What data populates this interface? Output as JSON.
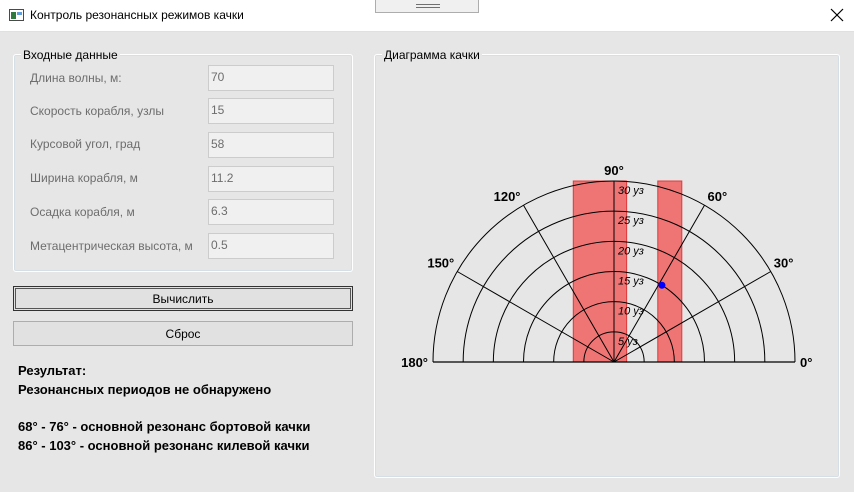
{
  "window": {
    "title": "Контроль резонансных режимов качки",
    "icon": "app-window-icon",
    "close_icon": "close-icon"
  },
  "input_group": {
    "title": "Входные данные",
    "fields": [
      {
        "label": "Длина волны, м:",
        "value": "70"
      },
      {
        "label": "Скорость корабля, узлы",
        "value": "15"
      },
      {
        "label": "Курсовой угол, град",
        "value": "58"
      },
      {
        "label": "Ширина корабля, м",
        "value": "11.2"
      },
      {
        "label": "Осадка корабля, м",
        "value": "6.3"
      },
      {
        "label": "Метацентрическая высота, м",
        "value": "0.5"
      }
    ]
  },
  "buttons": {
    "calculate": "Вычислить",
    "reset": "Сброс"
  },
  "result": {
    "title": "Результат:",
    "status": "Резонансных периодов не обнаружено",
    "roll": "68° - 76° - основной резонанс бортовой качки",
    "pitch": "86° - 103° - основной резонанс килевой качки"
  },
  "chart_group": {
    "title": "Диаграмма качки"
  },
  "chart_data": {
    "type": "polar",
    "angle_range": [
      0,
      180
    ],
    "angle_ticks": [
      0,
      30,
      60,
      90,
      120,
      150,
      180
    ],
    "angle_tick_labels": [
      "0°",
      "30°",
      "60°",
      "90°",
      "120°",
      "150°",
      "180°"
    ],
    "radial_unit": "уз",
    "radial_max": 30,
    "radial_ticks": [
      5,
      10,
      15,
      20,
      25,
      30
    ],
    "radial_tick_labels": [
      "5 уз",
      "10 уз",
      "15 уз",
      "20 уз",
      "25 уз",
      "30 уз"
    ],
    "grid": true,
    "resonance_bands": [
      {
        "name": "бортовая качка",
        "angle_from": 68,
        "angle_to": 76,
        "color": "#f07070"
      },
      {
        "name": "килевая качка",
        "angle_from": 86,
        "angle_to": 103,
        "color": "#f07070"
      }
    ],
    "point": {
      "angle": 58,
      "speed": 15,
      "color": "#0000ff"
    },
    "colors": {
      "grid": "#000000",
      "band_fill": "#f07070",
      "band_stroke": "#e03030"
    }
  }
}
